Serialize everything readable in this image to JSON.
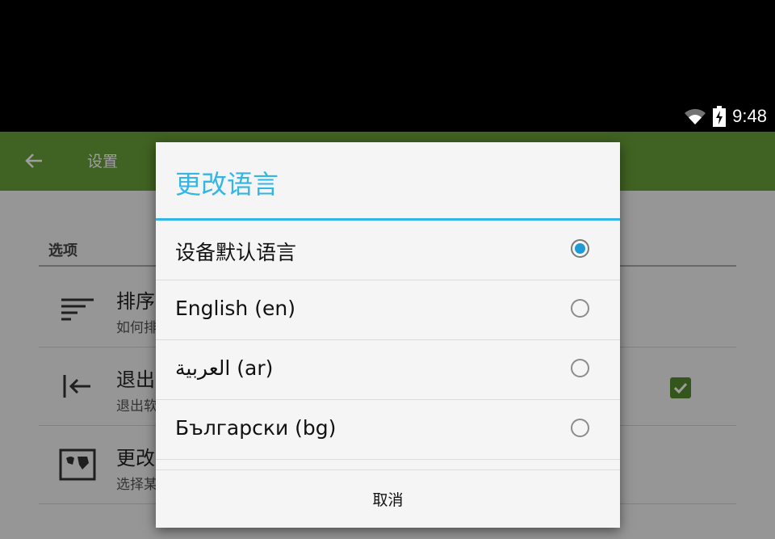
{
  "status_bar": {
    "time": "9:48",
    "icons": [
      "wifi-icon",
      "battery-charging-icon"
    ]
  },
  "toolbar": {
    "title": "设置",
    "back_icon": "arrow-left-icon",
    "color": "#689f38"
  },
  "settings": {
    "section_label": "选项",
    "rows": [
      {
        "title": "排序",
        "subtitle": "如何排",
        "icon": "sort-lines-icon"
      },
      {
        "title": "退出",
        "subtitle": "退出软",
        "icon": "exit-arrow-icon",
        "checked": true
      },
      {
        "title": "更改",
        "subtitle": "选择某",
        "icon": "world-map-icon"
      }
    ]
  },
  "dialog": {
    "title": "更改语言",
    "accent_color": "#33b5e5",
    "options": [
      {
        "label": "设备默认语言",
        "selected": true
      },
      {
        "label": "English (en)",
        "selected": false
      },
      {
        "label": "العربية (ar)",
        "selected": false
      },
      {
        "label": "Български (bg)",
        "selected": false
      }
    ],
    "cancel_label": "取消"
  }
}
